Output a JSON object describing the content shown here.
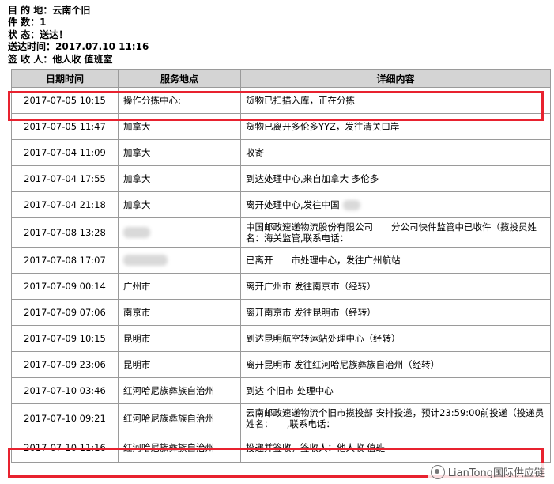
{
  "info": {
    "destination": "目 的 地：云南个旧",
    "count": "件 数：1",
    "status": "状 态：送达！",
    "delivered_time": "送达时间：2017.07.10 11:16",
    "signer": "签 收 人：他人收 值班室"
  },
  "table": {
    "headers": [
      "日期时间",
      "服务地点",
      "详细内容"
    ],
    "rows": [
      {
        "time": "2017-07-05 10:15",
        "place": "操作分拣中心:",
        "detail": "货物已扫描入库，正在分拣"
      },
      {
        "time": "2017-07-05 11:47",
        "place": "加拿大",
        "detail": "货物已离开多伦多YYZ，发往清关口岸"
      },
      {
        "time": "2017-07-04 11:09",
        "place": "加拿大",
        "detail": "收寄"
      },
      {
        "time": "2017-07-04 17:55",
        "place": "加拿大",
        "detail": "到达处理中心,来自加拿大 多伦多"
      },
      {
        "time": "2017-07-04 21:18",
        "place": "加拿大",
        "detail": "离开处理中心,发往中国"
      },
      {
        "time": "2017-07-08 13:28",
        "place": "",
        "detail": "中国邮政速递物流股份有限公司　　分公司快件监管中已收件（揽投员姓名：海关监管,联系电话："
      },
      {
        "time": "2017-07-08 17:07",
        "place": "",
        "detail": "已离开　　市处理中心，发往广州航站"
      },
      {
        "time": "2017-07-09 00:14",
        "place": "广州市",
        "detail": "离开广州市 发往南京市（经转）"
      },
      {
        "time": "2017-07-09 07:06",
        "place": "南京市",
        "detail": "离开南京市 发往昆明市（经转）"
      },
      {
        "time": "2017-07-09 10:15",
        "place": "昆明市",
        "detail": "到达昆明航空转运站处理中心（经转）"
      },
      {
        "time": "2017-07-09 23:06",
        "place": "昆明市",
        "detail": "离开昆明市 发往红河哈尼族彝族自治州（经转）"
      },
      {
        "time": "2017-07-10 03:46",
        "place": "红河哈尼族彝族自治州",
        "detail": "到达 个旧市 处理中心"
      },
      {
        "time": "2017-07-10 09:21",
        "place": "红河哈尼族彝族自治州",
        "detail": "云南邮政速递物流个旧市揽投部 安排投递，预计23:59:00前投递（投递员姓名：　　,联系电话："
      },
      {
        "time": "2017-07-10 11:16",
        "place": "红河哈尼族彝族自治州",
        "detail": "投递并签收，签收人：他人收 值班"
      }
    ]
  },
  "watermark": "LianTong国际供应链",
  "colors": {
    "highlight": "#e8222f",
    "header_bg": "#d4d4d4"
  }
}
